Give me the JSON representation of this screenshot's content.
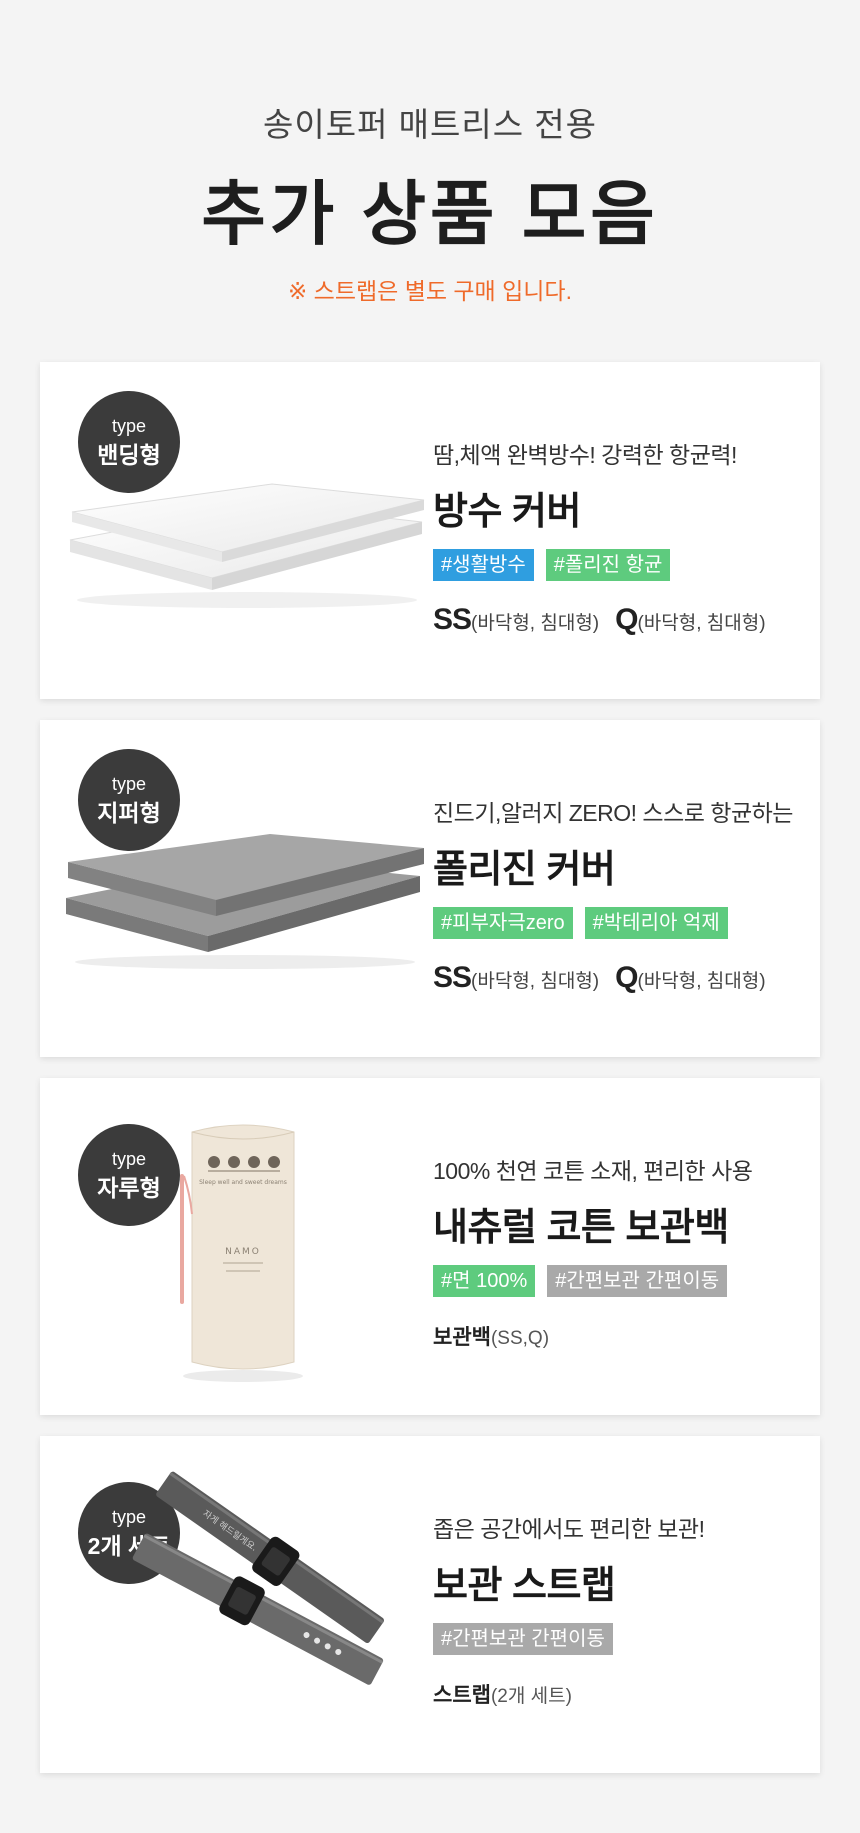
{
  "header": {
    "subtitle": "송이토퍼 매트리스 전용",
    "title": "추가 상품 모음",
    "notice": "※ 스트랩은 별도 구매 입니다."
  },
  "colors": {
    "blue_tag": "#2f9ee0",
    "green_tag": "#5ecb7e",
    "gray_tag": "#a9a9a9",
    "badge": "#3b3b3b",
    "notice": "#ef6a2a"
  },
  "products": [
    {
      "badge_type": "type",
      "badge_name": "밴딩형",
      "tagline": "땀,체액 완벽방수!  강력한 항균력!",
      "name": "방수 커버",
      "tags": [
        "#생활방수",
        "#폴리진 항균"
      ],
      "size1": "SS",
      "size1_note": "(바닥형, 침대형)",
      "size2": "Q",
      "size2_note": "(바닥형, 침대형)"
    },
    {
      "badge_type": "type",
      "badge_name": "지퍼형",
      "tagline": "진드기,알러지 ZERO! 스스로 항균하는",
      "name": "폴리진 커버",
      "tags": [
        "#피부자극zero",
        "#박테리아 억제"
      ],
      "size1": "SS",
      "size1_note": "(바닥형, 침대형)",
      "size2": "Q",
      "size2_note": "(바닥형, 침대형)"
    },
    {
      "badge_type": "type",
      "badge_name": "자루형",
      "tagline": "100% 천연  코튼 소재,  편리한 사용",
      "name": "내츄럴 코튼 보관백",
      "tags": [
        "#면 100%",
        "#간편보관 간편이동"
      ],
      "detail_label": "보관백",
      "detail_note": "(SS,Q)",
      "bag_print": "Sleep well and sweet dreams",
      "bag_logo": "NAMO"
    },
    {
      "badge_type": "type",
      "badge_name": "2개 세트",
      "tagline": "좁은 공간에서도 편리한 보관!",
      "name": "보관 스트랩",
      "tags": [
        "#간편보관 간편이동"
      ],
      "detail_label": "스트랩",
      "detail_note": "(2개 세트)",
      "strap_print": "자게 해드릴게요."
    }
  ]
}
